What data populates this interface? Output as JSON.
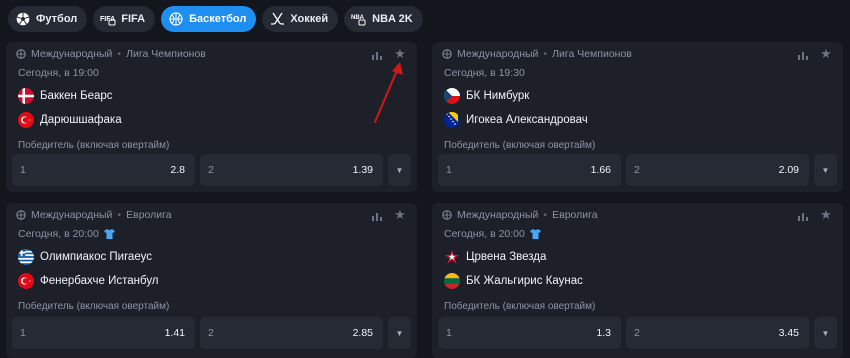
{
  "tabs": [
    {
      "label": "Футбол",
      "icon": "football-icon",
      "active": false
    },
    {
      "label": "FIFA",
      "icon": "fifa-icon",
      "active": false
    },
    {
      "label": "Баскетбол",
      "icon": "basketball-icon",
      "active": true
    },
    {
      "label": "Хоккей",
      "icon": "hockey-icon",
      "active": false
    },
    {
      "label": "NBA 2K",
      "icon": "nba2k-icon",
      "active": false
    }
  ],
  "fifa_badge": "FIFA",
  "nba_badge": "NBA",
  "league_separator": "•",
  "matches": [
    {
      "region": "Международный",
      "league": "Лига Чемпионов",
      "time": "Сегодня, в 19:00",
      "live_icon": false,
      "team1": {
        "name": "Баккен Беарс",
        "flag": "denmark-flag-icon"
      },
      "team2": {
        "name": "Дарюшшафака",
        "flag": "turkey-flag-icon"
      },
      "market": "Победитель (включая овертайм)",
      "odds": [
        {
          "label": "1",
          "value": "2.8"
        },
        {
          "label": "2",
          "value": "1.39"
        }
      ]
    },
    {
      "region": "Международный",
      "league": "Лига Чемпионов",
      "time": "Сегодня, в 19:30",
      "live_icon": false,
      "team1": {
        "name": "БК Нимбурк",
        "flag": "czech-flag-icon"
      },
      "team2": {
        "name": "Игокеа Александровач",
        "flag": "bosnia-flag-icon"
      },
      "market": "Победитель (включая овертайм)",
      "odds": [
        {
          "label": "1",
          "value": "1.66"
        },
        {
          "label": "2",
          "value": "2.09"
        }
      ]
    },
    {
      "region": "Международный",
      "league": "Евролига",
      "time": "Сегодня, в 20:00",
      "live_icon": true,
      "team1": {
        "name": "Олимпиакос Пиraеус",
        "flag": "greece-flag-icon"
      },
      "team2": {
        "name": "Фенербахче Истанбул",
        "flag": "turkey-flag-icon"
      },
      "market": "Победитель (включая овертайм)",
      "odds": [
        {
          "label": "1",
          "value": "1.41"
        },
        {
          "label": "2",
          "value": "2.85"
        }
      ]
    },
    {
      "region": "Международный",
      "league": "Евролига",
      "time": "Сегодня, в 20:00",
      "live_icon": true,
      "team1": {
        "name": "Црвена Звезда",
        "flag": "crvena-zvezda-logo-icon"
      },
      "team2": {
        "name": "БК Жальгирис Каунас",
        "flag": "lithuania-flag-icon"
      },
      "market": "Победитель (включая овертайм)",
      "odds": [
        {
          "label": "1",
          "value": "1.3"
        },
        {
          "label": "2",
          "value": "3.45"
        }
      ]
    }
  ],
  "star_glyph": "★",
  "more_glyph": "▼",
  "colors": {
    "accent": "#1f8ef1",
    "background": "#14161d",
    "card": "#1d2029",
    "odd_button": "#262a35",
    "annotation_arrow": "#d01818"
  }
}
